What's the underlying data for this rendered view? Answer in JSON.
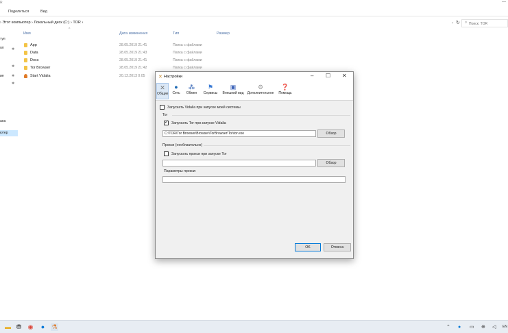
{
  "explorer": {
    "window_title_fragment": "R",
    "ribbon_tabs": [
      "Поделиться",
      "Вид"
    ],
    "breadcrumb": [
      "Этот компьютер",
      "Локальный диск (C:)",
      "TOR"
    ],
    "search_placeholder": "Поиск: TOR",
    "nav_items": [
      "туп",
      "ол",
      "ия",
      "ана",
      "ютер"
    ],
    "columns": {
      "name": "Имя",
      "date": "Дата изменения",
      "type": "Тип",
      "size": "Размер"
    },
    "files": [
      {
        "name": "App",
        "date": "28.05.2019 21:41",
        "type": "Папка с файлами",
        "icon": "folder-icon"
      },
      {
        "name": "Data",
        "date": "28.05.2019 21:43",
        "type": "Папка с файлами",
        "icon": "folder-icon"
      },
      {
        "name": "Docs",
        "date": "28.05.2019 21:41",
        "type": "Папка с файлами",
        "icon": "folder-icon"
      },
      {
        "name": "Tor Browser",
        "date": "28.05.2019 21:42",
        "type": "Папка с файлами",
        "icon": "folder-icon"
      },
      {
        "name": "Start Vidalia",
        "date": "20.12.2013 0:05",
        "type": "",
        "icon": "vidalia-app-icon"
      }
    ]
  },
  "dialog": {
    "title": "Настройки",
    "toolbar": [
      {
        "label": "Общие",
        "icon": "wrench-icon",
        "active": true
      },
      {
        "label": "Сеть",
        "icon": "globe-icon"
      },
      {
        "label": "Обмен",
        "icon": "relay-icon"
      },
      {
        "label": "Сервисы",
        "icon": "flag-icon"
      },
      {
        "label": "Внешний вид",
        "icon": "appearance-icon"
      },
      {
        "label": "Дополнительное",
        "icon": "advanced-gear-icon"
      },
      {
        "label": "Помощь",
        "icon": "help-icon"
      }
    ],
    "start_with_system": {
      "label": "Запускать Vidalia при запуске моей системы",
      "checked": false
    },
    "tor_group": "Tor",
    "start_tor": {
      "label": "Запускать Tor при запуске Vidalia",
      "checked": true
    },
    "tor_path": "C:\\TOR\\Tor Browser\\Browser\\TorBrowser\\Tor\\tor.exe",
    "browse_label": "Обзор",
    "proxy_group": "Прокси (необязательно)",
    "start_proxy": {
      "label": "Запускать прокси при запуске Tor",
      "checked": false
    },
    "proxy_path": "",
    "proxy_params_label": "Параметры прокси:",
    "proxy_params": "",
    "ok_label": "OK",
    "cancel_label": "Отмена"
  },
  "taskbar": {
    "pinned": [
      "file-explorer-icon",
      "store-icon",
      "chrome-icon",
      "skype-icon",
      "vidalia-icon"
    ],
    "tray": [
      "chevron-up-icon",
      "skype-tray-icon",
      "battery-icon",
      "network-icon",
      "volume-icon"
    ],
    "language": "EN"
  },
  "colors": {
    "selection": "#cce8ff",
    "accent": "#0078d7",
    "taskbar": "#e8edf3"
  }
}
